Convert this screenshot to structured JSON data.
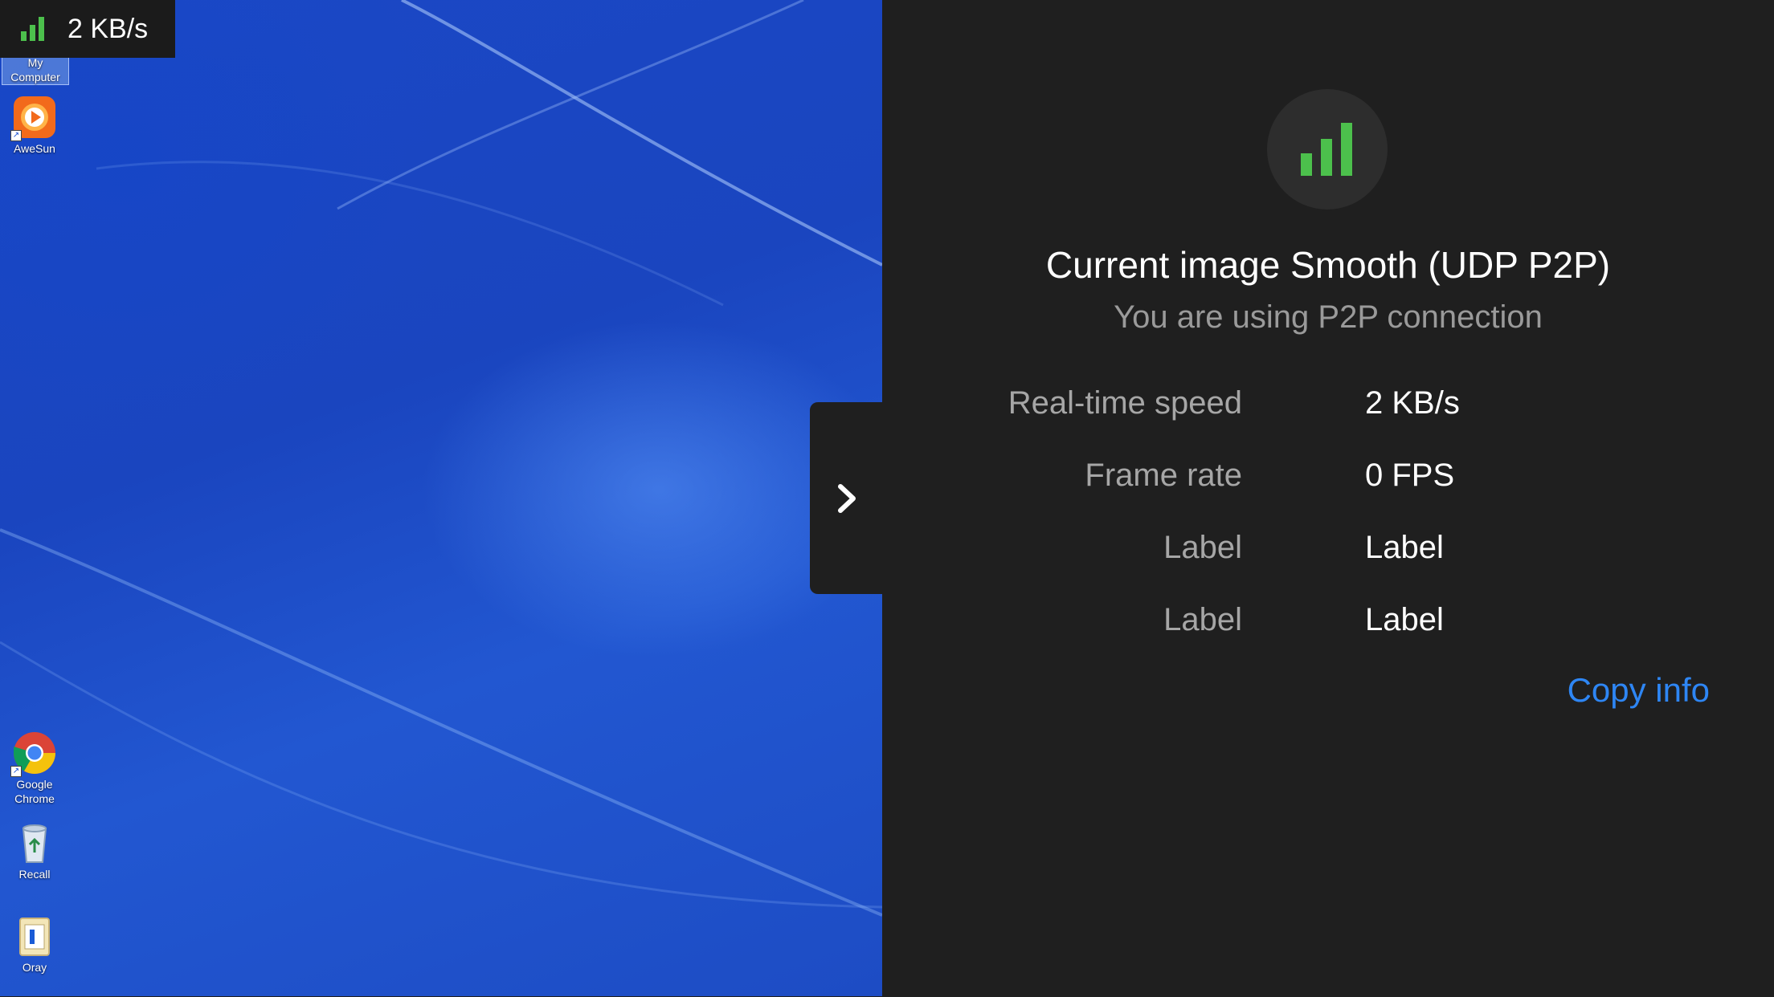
{
  "top_chip": {
    "speed": "2 KB/s",
    "icon": "signal-bars-icon"
  },
  "desktop": {
    "icons": [
      {
        "label": "My\nComputer",
        "icon": "my-computer-icon"
      },
      {
        "label": "AweSun",
        "icon": "awesun-icon"
      },
      {
        "label": "Google\nChrome",
        "icon": "chrome-icon"
      },
      {
        "label": "Recall",
        "icon": "recycle-bin-icon"
      },
      {
        "label": "Oray",
        "icon": "oray-folder-icon"
      }
    ]
  },
  "collapse_tab": {
    "icon": "chevron-right-icon"
  },
  "panel": {
    "status_icon": "signal-bars-icon",
    "title": "Current image Smooth (UDP P2P)",
    "subtitle": "You are using P2P connection",
    "rows": [
      {
        "label": "Real-time speed",
        "value": "2 KB/s"
      },
      {
        "label": "Frame rate",
        "value": "0 FPS"
      },
      {
        "label": "Label",
        "value": "Label"
      },
      {
        "label": "Label",
        "value": "Label"
      }
    ],
    "copy_label": "Copy info"
  },
  "colors": {
    "signal_green": "#4cc04c",
    "link_blue": "#2e86f4",
    "panel_bg": "#1f1f1f"
  }
}
